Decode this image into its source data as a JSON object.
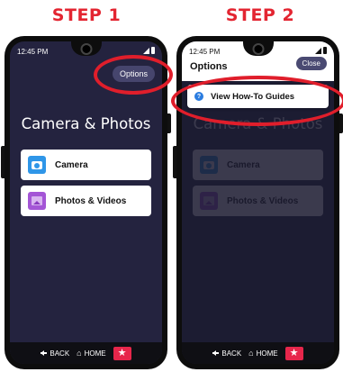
{
  "steps": [
    {
      "title": "STEP 1",
      "status_time": "12:45 PM",
      "options_label": "Options",
      "section_title": "Camera & Photos",
      "tiles": [
        {
          "label": "Camera",
          "icon": "camera-icon"
        },
        {
          "label": "Photos & Videos",
          "icon": "photos-icon"
        }
      ],
      "nav": {
        "back": "BACK",
        "home": "HOME",
        "star": "★"
      }
    },
    {
      "title": "STEP 2",
      "status_time": "12:45 PM",
      "header_title": "Options",
      "close_label": "Close",
      "menu_item": "View How-To Guides",
      "help_glyph": "?",
      "section_title": "Camera & Photos",
      "tiles": [
        {
          "label": "Camera",
          "icon": "camera-icon"
        },
        {
          "label": "Photos & Videos",
          "icon": "photos-icon"
        }
      ],
      "nav": {
        "back": "BACK",
        "home": "HOME",
        "star": "★"
      }
    }
  ],
  "colors": {
    "step_title": "#e32531",
    "highlight_ring": "#e01e2b",
    "screen_bg": "#24233f",
    "options_button": "#46456d",
    "star_button": "#e7264b"
  }
}
